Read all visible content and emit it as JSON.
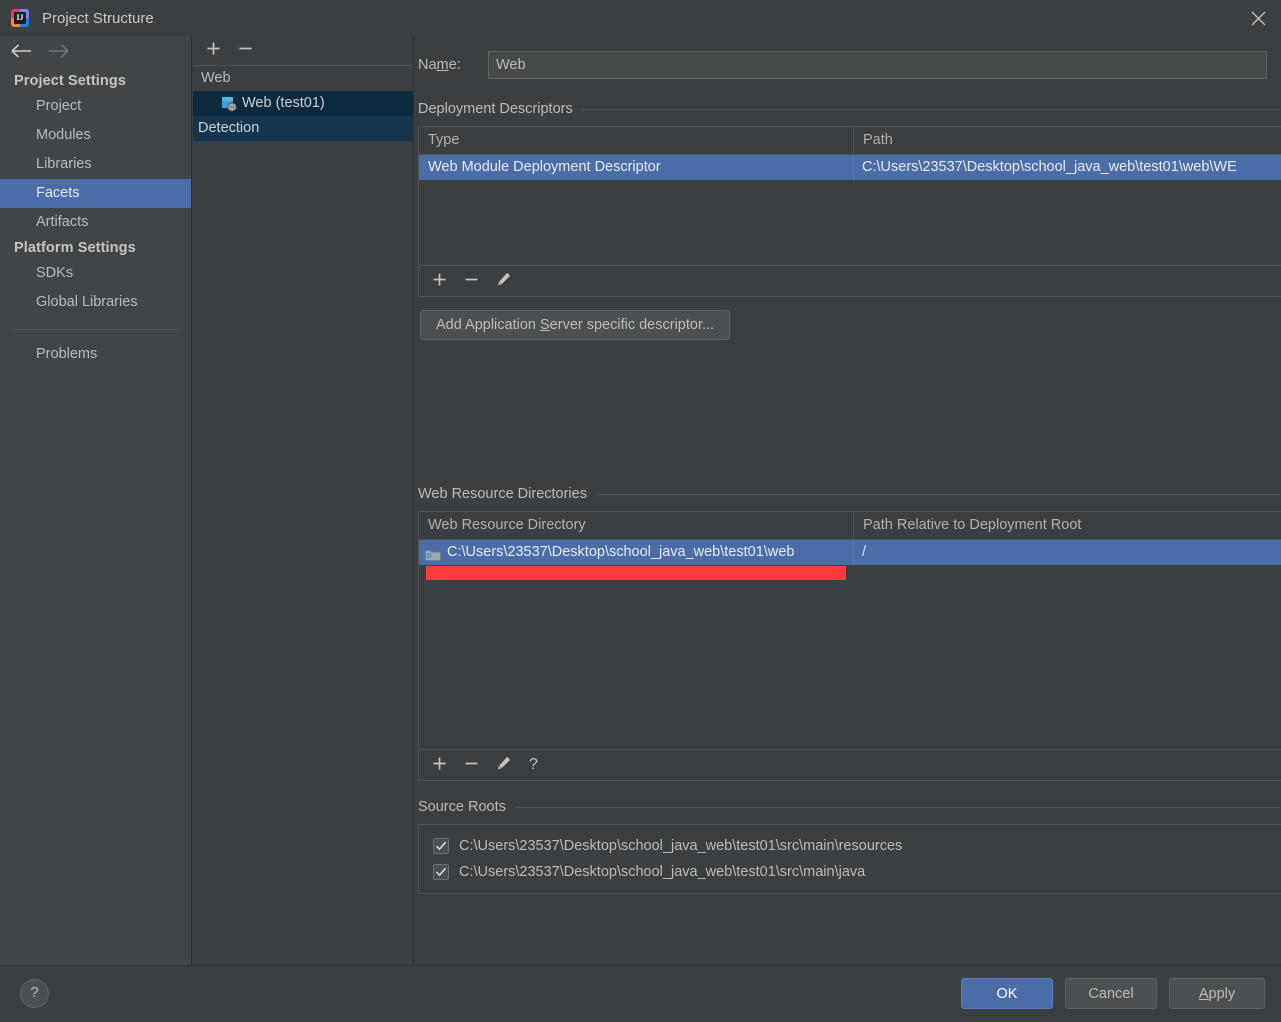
{
  "window": {
    "title": "Project Structure",
    "app_icon": "intellij-idea-icon",
    "close_icon": "close-icon"
  },
  "sidebar": {
    "back_icon": "back-arrow-icon",
    "forward_icon": "forward-arrow-icon",
    "groups": [
      {
        "label": "Project Settings",
        "items": [
          {
            "label": "Project",
            "selected": false
          },
          {
            "label": "Modules",
            "selected": false
          },
          {
            "label": "Libraries",
            "selected": false
          },
          {
            "label": "Facets",
            "selected": true
          },
          {
            "label": "Artifacts",
            "selected": false
          }
        ]
      },
      {
        "label": "Platform Settings",
        "items": [
          {
            "label": "SDKs",
            "selected": false
          },
          {
            "label": "Global Libraries",
            "selected": false
          }
        ]
      }
    ],
    "problems": {
      "label": "Problems",
      "selected": false
    }
  },
  "facet_tree": {
    "toolbar": {
      "add_icon": "plus-icon",
      "remove_icon": "minus-icon"
    },
    "rows": [
      {
        "label": "Web",
        "type": "group",
        "selected": false
      },
      {
        "label": "Web (test01)",
        "type": "child",
        "selected": true,
        "icon": "web-facet-icon"
      },
      {
        "label": "Detection",
        "type": "detection",
        "selected": true
      }
    ]
  },
  "main": {
    "name": {
      "label_prefix": "Na",
      "label_mnemonic": "m",
      "label_suffix": "e:",
      "value": "Web"
    },
    "deployment_descriptors": {
      "title": "Deployment Descriptors",
      "columns": [
        "Type",
        "Path"
      ],
      "rows": [
        {
          "type": "Web Module Deployment Descriptor",
          "path": "C:\\Users\\23537\\Desktop\\school_java_web\\test01\\web\\WE",
          "selected": true
        }
      ],
      "toolbar": {
        "add_icon": "plus-icon",
        "remove_icon": "minus-icon",
        "edit_icon": "pencil-icon"
      },
      "add_app_server_button": {
        "prefix": "Add Application ",
        "mnemonic": "S",
        "suffix": "erver specific descriptor..."
      }
    },
    "web_resource_directories": {
      "title": "Web Resource Directories",
      "columns": [
        "Web Resource Directory",
        "Path Relative to Deployment Root"
      ],
      "rows": [
        {
          "directory": "C:\\Users\\23537\\Desktop\\school_java_web\\test01\\web",
          "relative_path": "/",
          "selected": true,
          "icon": "folder-icon"
        }
      ],
      "toolbar": {
        "add_icon": "plus-icon",
        "remove_icon": "minus-icon",
        "edit_icon": "pencil-icon",
        "help_icon": "question-mark-icon"
      },
      "annotation": {
        "name": "red-highlight-bar",
        "color": "#fc3c3c"
      }
    },
    "source_roots": {
      "title": "Source Roots",
      "rows": [
        {
          "path": "C:\\Users\\23537\\Desktop\\school_java_web\\test01\\src\\main\\resources",
          "checked": true
        },
        {
          "path": "C:\\Users\\23537\\Desktop\\school_java_web\\test01\\src\\main\\java",
          "checked": true
        }
      ]
    }
  },
  "footer": {
    "help_label": "?",
    "ok_label": "OK",
    "cancel_label": "Cancel",
    "apply_mnemonic": "A",
    "apply_suffix": "pply"
  },
  "colors": {
    "selection_blue": "#4a6da7",
    "tree_selection": "#0d293e",
    "annotation_red": "#fc3c3c",
    "background": "#3c3f41",
    "sidebar_background": "#414547"
  }
}
